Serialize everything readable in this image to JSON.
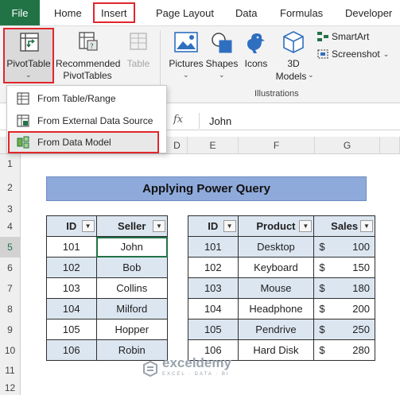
{
  "ribbon_tabs": {
    "file": "File",
    "home": "Home",
    "insert": "Insert",
    "page_layout": "Page Layout",
    "data": "Data",
    "formulas": "Formulas",
    "developer": "Developer"
  },
  "ribbon": {
    "pivot_table": "PivotTable",
    "recommended_line1": "Recommended",
    "recommended_line2": "PivotTables",
    "table": "Table",
    "pictures": "Pictures",
    "shapes": "Shapes",
    "icons": "Icons",
    "models_line1": "3D",
    "models_line2": "Models",
    "smartart": "SmartArt",
    "screenshot": "Screenshot",
    "illustrations_group": "Illustrations"
  },
  "pivot_menu": {
    "items": [
      "From Table/Range",
      "From External Data Source",
      "From Data Model"
    ]
  },
  "formula_bar": {
    "fx": "fx",
    "value": "John"
  },
  "sheet": {
    "columns": [
      "D",
      "E",
      "F",
      "G"
    ],
    "rows": [
      "1",
      "2",
      "3",
      "4",
      "5",
      "6",
      "7",
      "8",
      "9",
      "10",
      "11",
      "12"
    ],
    "title": "Applying Power Query"
  },
  "table1": {
    "headers": [
      "ID",
      "Seller"
    ],
    "rows": [
      [
        "101",
        "John"
      ],
      [
        "102",
        "Bob"
      ],
      [
        "103",
        "Collins"
      ],
      [
        "104",
        "Milford"
      ],
      [
        "105",
        "Hopper"
      ],
      [
        "106",
        "Robin"
      ]
    ]
  },
  "table2": {
    "headers": [
      "ID",
      "Product",
      "Sales"
    ],
    "currency": "$",
    "rows": [
      [
        "101",
        "Desktop",
        "100"
      ],
      [
        "102",
        "Keyboard",
        "150"
      ],
      [
        "103",
        "Mouse",
        "180"
      ],
      [
        "104",
        "Headphone",
        "200"
      ],
      [
        "105",
        "Pendrive",
        "250"
      ],
      [
        "106",
        "Hard Disk",
        "280"
      ]
    ]
  },
  "watermark": {
    "name": "exceldemy",
    "sub": "EXCEL · DATA · BI"
  },
  "colors": {
    "excel_green": "#217346",
    "highlight_red": "#e0262c",
    "title_blue": "#8eaadb",
    "band_blue": "#dce6f1"
  }
}
